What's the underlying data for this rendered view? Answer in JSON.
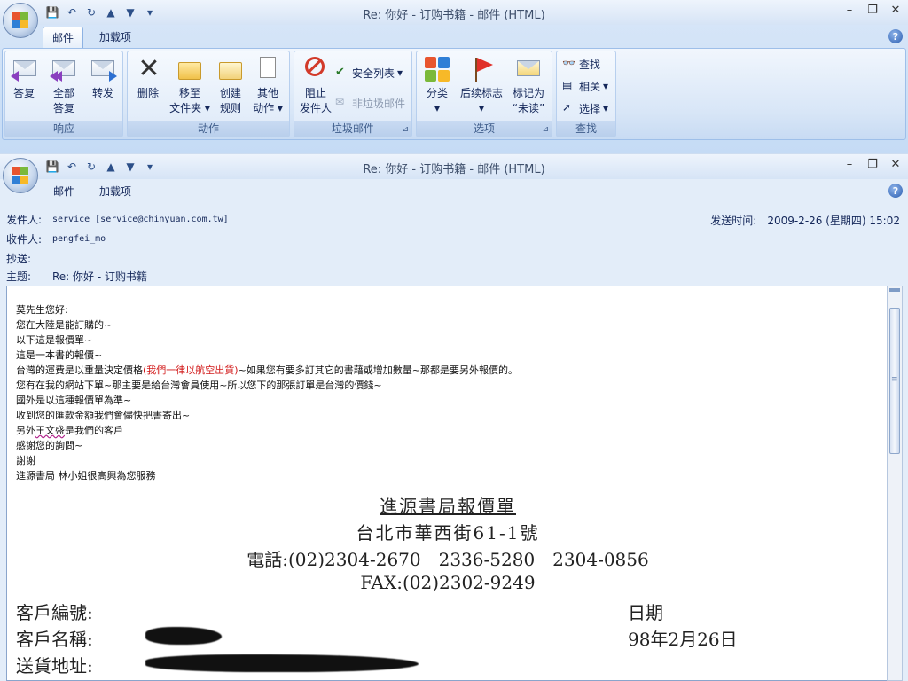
{
  "window": {
    "title": "Re: 你好 - 订购书籍 - 邮件 (HTML)",
    "tabs": [
      "邮件",
      "加载项"
    ]
  },
  "ribbon": {
    "groups": {
      "respond": "响应",
      "actions": "动作",
      "junk": "垃圾邮件",
      "options": "选项",
      "find": "查找"
    },
    "buttons": {
      "reply": "答复",
      "reply_all_1": "全部",
      "reply_all_2": "答复",
      "forward": "转发",
      "delete": "删除",
      "move_1": "移至",
      "move_2": "文件夹",
      "create_rule_1": "创建",
      "create_rule_2": "规则",
      "other_1": "其他",
      "other_2": "动作",
      "block_1": "阻止",
      "block_2": "发件人",
      "safe_list": "安全列表",
      "not_junk": "非垃圾邮件",
      "categorize": "分类",
      "follow_up": "后续标志",
      "mark_unread_1": "标记为",
      "mark_unread_2": "“未读”",
      "find": "查找",
      "related": "相关",
      "select": "选择"
    }
  },
  "header": {
    "from_label": "发件人:",
    "from_value": "service [service@chinyuan.com.tw]",
    "to_label": "收件人:",
    "to_value": "pengfei_mo",
    "cc_label": "抄送:",
    "cc_value": "",
    "subject_label": "主题:",
    "subject_value": "Re: 你好 - 订购书籍",
    "sent_label": "发送时间:",
    "sent_value": "2009-2-26 (星期四) 15:02"
  },
  "message": {
    "lines": [
      "莫先生您好:",
      "您在大陸是能訂購的~",
      "以下這是報價單~",
      "這是一本書的報價~"
    ],
    "line5_pre": "台灣的運費是以重量決定價格",
    "line5_red": "(我們一律以航空出貨)",
    "line5_post": "~如果您有要多訂其它的書藉或增加數量~那都是要另外報價的。",
    "line6": "您有在我的網站下單~那主要是給台灣會員使用~所以您下的那張訂單是台灣的價錢~",
    "line7": "國外是以這種報價單為準~",
    "line8": "收到您的匯款金額我們會儘快把書寄出~",
    "line9_pre": "另外",
    "line9_und": "王文盛",
    "line9_post": "是我們的客戶",
    "line10": "感謝您的詢問~",
    "line11": "謝謝",
    "line12": "進源書局 林小姐很高興為您服務"
  },
  "quote": {
    "title": "進源書局報價單",
    "address": "台北市華西街61-1號",
    "phone": "電話:(02)2304-2670　2336-5280　2304-0856",
    "fax": "FAX:(02)2302-9249",
    "customer_no_label": "客戶編號:",
    "customer_name_label": "客戶名稱:",
    "delivery_label": "送貨地址:",
    "date_label": "日期",
    "date_value": "98年2月26日"
  }
}
